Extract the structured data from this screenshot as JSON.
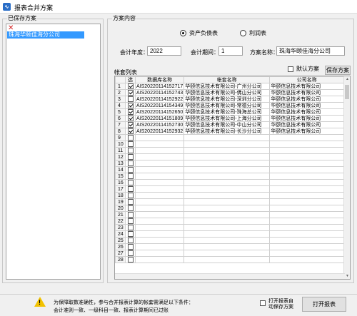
{
  "window": {
    "title": "报表合并方案",
    "icon": "app-icon"
  },
  "saved_schemes": {
    "group_label": "已保存方案",
    "delete_icon": "delete-icon",
    "items": [
      "珠海华颐佳海分公司"
    ]
  },
  "scheme_content": {
    "group_label": "方案内容",
    "report_type": {
      "options": [
        "资产负债表",
        "利润表"
      ],
      "selected": "资产负债表"
    },
    "fields": {
      "year_label": "会计年度：",
      "year_value": "2022",
      "period_label": "会计期间：",
      "period_value": "1",
      "name_label": "方案名称：",
      "name_value": "珠海华颐佳海分公司"
    }
  },
  "account_sets": {
    "label": "帐套列表",
    "default_checkbox_label": "默认方案",
    "default_checked": false,
    "save_button": "保存方案",
    "columns": [
      "选",
      "数据库名称",
      "帐套名称",
      "公司名称"
    ],
    "rows": [
      {
        "n": "1",
        "checked": true,
        "db": "AIS20220114152717",
        "set": "华颐信息技术有限公司-广州分公司",
        "company": "华颐信息技术有限公司"
      },
      {
        "n": "2",
        "checked": true,
        "db": "AIS20220114152743",
        "set": "华颐信息技术有限公司-佛山分公司",
        "company": "华颐信息技术有限公司"
      },
      {
        "n": "3",
        "checked": false,
        "db": "AIS20220114152922",
        "set": "华颐信息技术有限公司-深圳分公司",
        "company": "华颐信息技术有限公司"
      },
      {
        "n": "4",
        "checked": true,
        "db": "AIS20220114154349",
        "set": "华颐信息技术有限公司-常德分公司",
        "company": "华颐信息技术有限公司"
      },
      {
        "n": "5",
        "checked": true,
        "db": "AIS20220114152650",
        "set": "华颐信息技术有限公司-珠海总公司",
        "company": "华颐信息技术有限公司"
      },
      {
        "n": "6",
        "checked": true,
        "db": "AIS20220114151809",
        "set": "华颐信息技术有限公司-上海分公司",
        "company": "华颐信息技术有限公司"
      },
      {
        "n": "7",
        "checked": true,
        "db": "AIS20220114152730",
        "set": "华颐信息技术有限公司-中山分公司",
        "company": "华颐信息技术有限公司"
      },
      {
        "n": "8",
        "checked": true,
        "db": "AIS20220114152932",
        "set": "华颐信息技术有限公司-长沙分公司",
        "company": "华颐信息技术有限公司"
      },
      {
        "n": "9",
        "checked": false,
        "db": "",
        "set": "",
        "company": ""
      },
      {
        "n": "10",
        "checked": false,
        "db": "",
        "set": "",
        "company": ""
      },
      {
        "n": "11",
        "checked": false,
        "db": "",
        "set": "",
        "company": ""
      },
      {
        "n": "12",
        "checked": false,
        "db": "",
        "set": "",
        "company": ""
      },
      {
        "n": "13",
        "checked": false,
        "db": "",
        "set": "",
        "company": ""
      },
      {
        "n": "14",
        "checked": false,
        "db": "",
        "set": "",
        "company": ""
      },
      {
        "n": "15",
        "checked": false,
        "db": "",
        "set": "",
        "company": ""
      },
      {
        "n": "16",
        "checked": false,
        "db": "",
        "set": "",
        "company": ""
      },
      {
        "n": "17",
        "checked": false,
        "db": "",
        "set": "",
        "company": ""
      },
      {
        "n": "18",
        "checked": false,
        "db": "",
        "set": "",
        "company": ""
      },
      {
        "n": "19",
        "checked": false,
        "db": "",
        "set": "",
        "company": ""
      },
      {
        "n": "20",
        "checked": false,
        "db": "",
        "set": "",
        "company": ""
      },
      {
        "n": "21",
        "checked": false,
        "db": "",
        "set": "",
        "company": ""
      },
      {
        "n": "22",
        "checked": false,
        "db": "",
        "set": "",
        "company": ""
      },
      {
        "n": "23",
        "checked": false,
        "db": "",
        "set": "",
        "company": ""
      },
      {
        "n": "24",
        "checked": false,
        "db": "",
        "set": "",
        "company": ""
      },
      {
        "n": "25",
        "checked": false,
        "db": "",
        "set": "",
        "company": ""
      },
      {
        "n": "26",
        "checked": false,
        "db": "",
        "set": "",
        "company": ""
      },
      {
        "n": "27",
        "checked": false,
        "db": "",
        "set": "",
        "company": ""
      },
      {
        "n": "28",
        "checked": false,
        "db": "",
        "set": "",
        "company": ""
      }
    ]
  },
  "footer": {
    "warning_icon": "warning-icon",
    "notice_line1": "为保障取数准确性，参与合并报表计算的帐套需满足以下条件：",
    "notice_line2": "会计准则一致、一级科目一致、报表计算期间已过账",
    "auto_save_label_1": "打开报表自",
    "auto_save_label_2": "动保存方案",
    "auto_save_checked": false,
    "open_button": "打开报表"
  },
  "colors": {
    "selection": "#3399ff",
    "warning": "#f2c200",
    "delete": "#d21c1c"
  }
}
